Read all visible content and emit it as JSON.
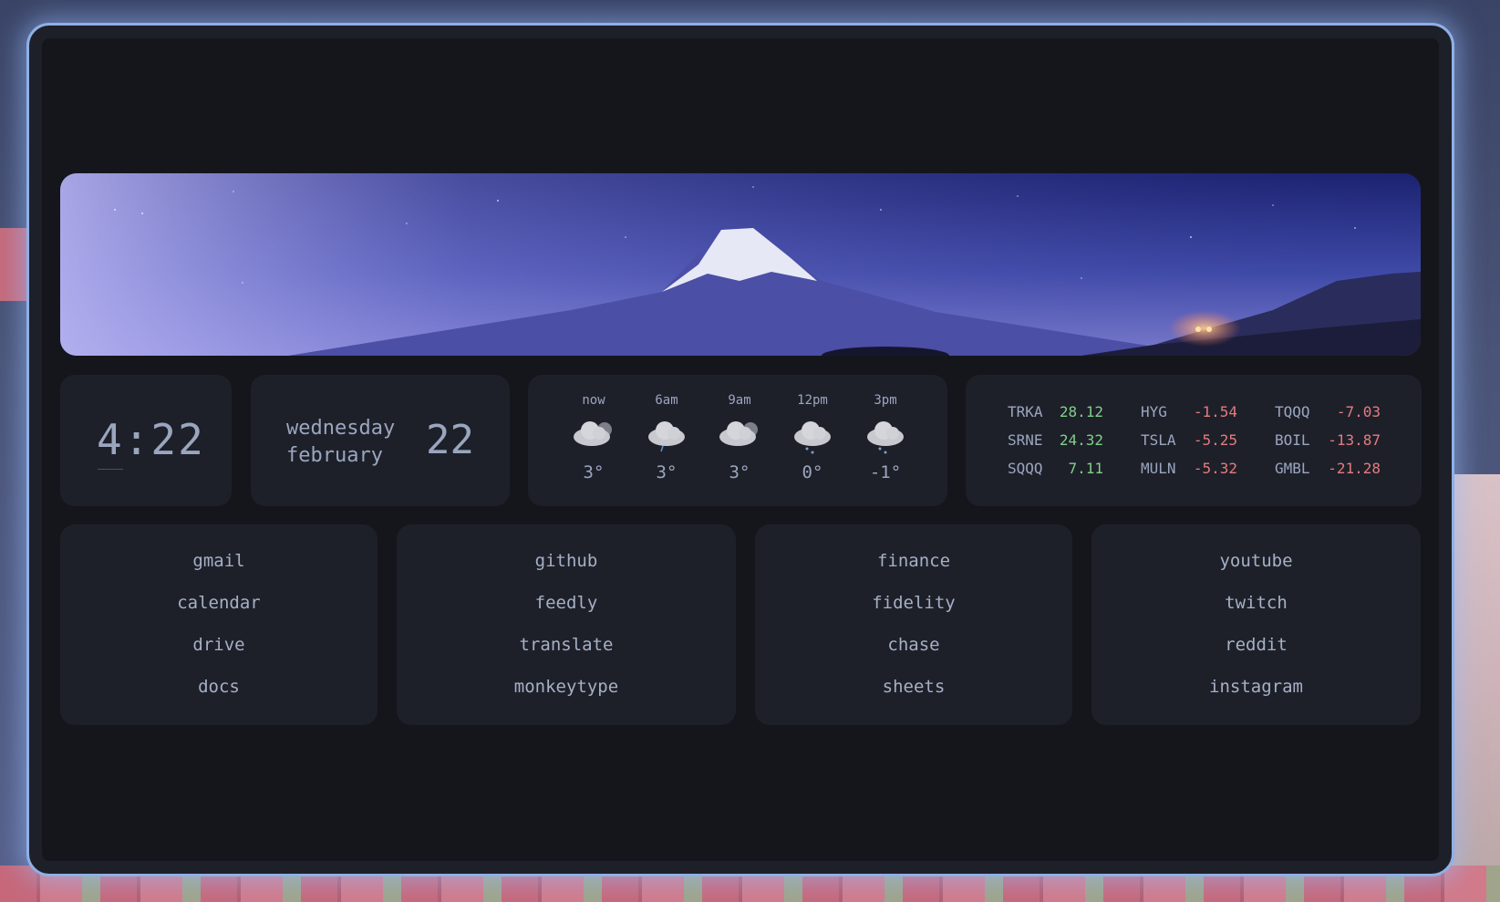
{
  "clock": {
    "time": "4:22"
  },
  "date": {
    "weekday": "wednesday",
    "month": "february",
    "day": "22"
  },
  "weather": [
    {
      "time": "now",
      "icon": "cloudy-icon",
      "temp": "3°"
    },
    {
      "time": "6am",
      "icon": "cloud-rain-icon",
      "temp": "3°"
    },
    {
      "time": "9am",
      "icon": "cloudy-icon",
      "temp": "3°"
    },
    {
      "time": "12pm",
      "icon": "cloud-snow-icon",
      "temp": "0°"
    },
    {
      "time": "3pm",
      "icon": "cloud-snow-icon",
      "temp": "-1°"
    }
  ],
  "stocks": [
    [
      {
        "symbol": "TRKA",
        "value": "28.12",
        "trend": "up"
      },
      {
        "symbol": "HYG",
        "value": "-1.54",
        "trend": "down"
      },
      {
        "symbol": "TQQQ",
        "value": "-7.03",
        "trend": "down"
      }
    ],
    [
      {
        "symbol": "SRNE",
        "value": "24.32",
        "trend": "up"
      },
      {
        "symbol": "TSLA",
        "value": "-5.25",
        "trend": "down"
      },
      {
        "symbol": "BOIL",
        "value": "-13.87",
        "trend": "down"
      }
    ],
    [
      {
        "symbol": "SQQQ",
        "value": "7.11",
        "trend": "up"
      },
      {
        "symbol": "MULN",
        "value": "-5.32",
        "trend": "down"
      },
      {
        "symbol": "GMBL",
        "value": "-21.28",
        "trend": "down"
      }
    ]
  ],
  "colors": {
    "positive": "#7fd18a",
    "negative": "#e57b7f",
    "accent": "#9aa6bf",
    "card": "#1e2029",
    "background": "#15161c"
  },
  "links": [
    [
      "gmail",
      "calendar",
      "drive",
      "docs"
    ],
    [
      "github",
      "feedly",
      "translate",
      "monkeytype"
    ],
    [
      "finance",
      "fidelity",
      "chase",
      "sheets"
    ],
    [
      "youtube",
      "twitch",
      "reddit",
      "instagram"
    ]
  ]
}
